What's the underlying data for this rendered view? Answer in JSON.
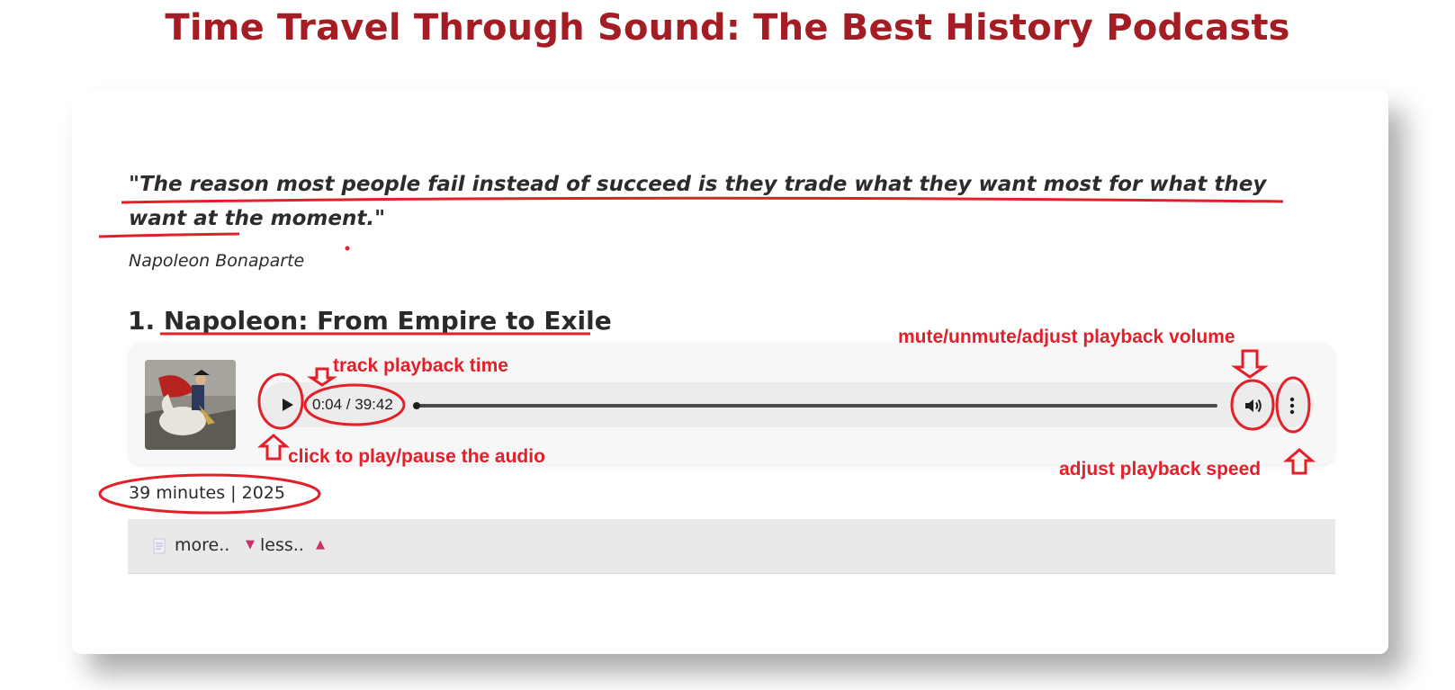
{
  "page": {
    "title": "Time Travel Through Sound: The Best History Podcasts"
  },
  "quote": {
    "text": "\"The reason most people fail instead of succeed is they trade what they want most for what they want at the moment.\"",
    "author": "Napoleon Bonaparte"
  },
  "episode": {
    "number": "1.",
    "title": "Napoleon: From Empire to Exile",
    "meta": "39 minutes | 2025"
  },
  "player": {
    "current_time": "0:04",
    "duration": "39:42",
    "time_display": "0:04 / 39:42",
    "progress_fraction": 0.0017,
    "play_icon": "play-icon",
    "volume_icon": "volume-icon",
    "menu_icon": "more-vertical-icon"
  },
  "details": {
    "more_label": "more..",
    "less_label": "less..",
    "doc_icon": "document-icon",
    "accent_color": "#c8336b"
  },
  "annotations": {
    "track_time": "track playback time",
    "play_pause": "click to play/pause the audio",
    "volume": "mute/unmute/adjust playback volume",
    "speed": "adjust playback speed",
    "color": "#e3202a"
  },
  "colors": {
    "title": "#a51d24",
    "text": "#2a2a2a"
  }
}
